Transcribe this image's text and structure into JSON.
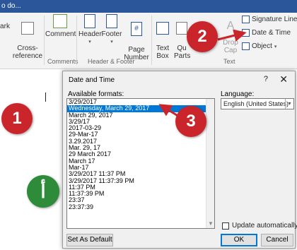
{
  "window": {
    "search_hint": "o do..."
  },
  "ribbon": {
    "buttons": {
      "mark_label": "ark",
      "cross_ref_label": "Cross-\nreference",
      "comment_label": "Comment",
      "header_label": "Header",
      "footer_label": "Footer",
      "page_number_label": "Page\nNumber",
      "text_box_label": "Text\nBox",
      "quick_parts_label": "Qu\nParts",
      "drop_cap_label": "Drop\nCap",
      "signature_line_label": "Signature Line",
      "date_time_label": "Date & Time",
      "object_label": "Object"
    },
    "groups": {
      "comments": "Comments",
      "header_footer": "Header & Footer",
      "text": "Text"
    }
  },
  "dialog": {
    "title": "Date and Time",
    "help": "?",
    "close": "✕",
    "available_label": "Available formats:",
    "language_label": "Language:",
    "language_value": "English (United States)",
    "formats": [
      "3/29/2017",
      "Wednesday, March 29, 2017",
      "March 29, 2017",
      "3/29/17",
      "2017-03-29",
      "29-Mar-17",
      "3.29.2017",
      "Mar. 29, 17",
      "29 March 2017",
      "March 17",
      "Mar-17",
      "3/29/2017 11:37 PM",
      "3/29/2017 11:37:39 PM",
      "11:37 PM",
      "11:37:39 PM",
      "23:37",
      "23:37:39"
    ],
    "selected_index": 1,
    "update_label": "Update automatically",
    "update_checked": false,
    "set_default_label": "Set As Default",
    "ok_label": "OK",
    "cancel_label": "Cancel"
  },
  "markers": {
    "m1": "1",
    "m2": "2",
    "m3": "3",
    "m4": "أ"
  },
  "colors": {
    "accent": "#2b579a",
    "selection": "#0078d7",
    "marker_red": "#c9252b",
    "marker_green": "#2e8b3a"
  }
}
